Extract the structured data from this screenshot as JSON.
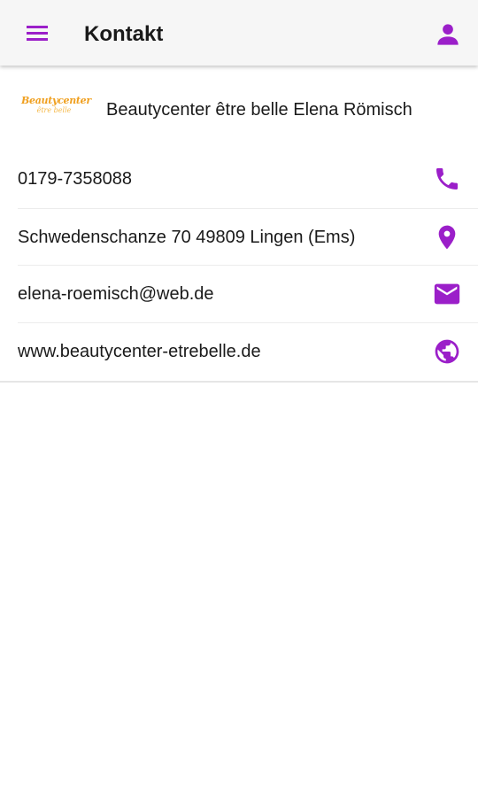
{
  "app": {
    "title": "Kontakt",
    "accent_color": "#9b1fc9"
  },
  "icons": {
    "menu": "hamburger-menu-icon",
    "profile": "person-icon",
    "phone": "phone-icon",
    "location": "map-pin-icon",
    "email": "envelope-icon",
    "website": "globe-icon"
  },
  "business": {
    "logo_line1": "Beautycenter",
    "logo_line2": "être belle",
    "name": "Beautycenter être belle Elena Römisch"
  },
  "contacts": [
    {
      "type": "phone",
      "text": "0179-7358088"
    },
    {
      "type": "address",
      "text": "Schwedenschanze 70 49809 Lingen (Ems)"
    },
    {
      "type": "email",
      "text": "elena-roemisch@web.de"
    },
    {
      "type": "website",
      "text": "www.beautycenter-etrebelle.de"
    }
  ]
}
